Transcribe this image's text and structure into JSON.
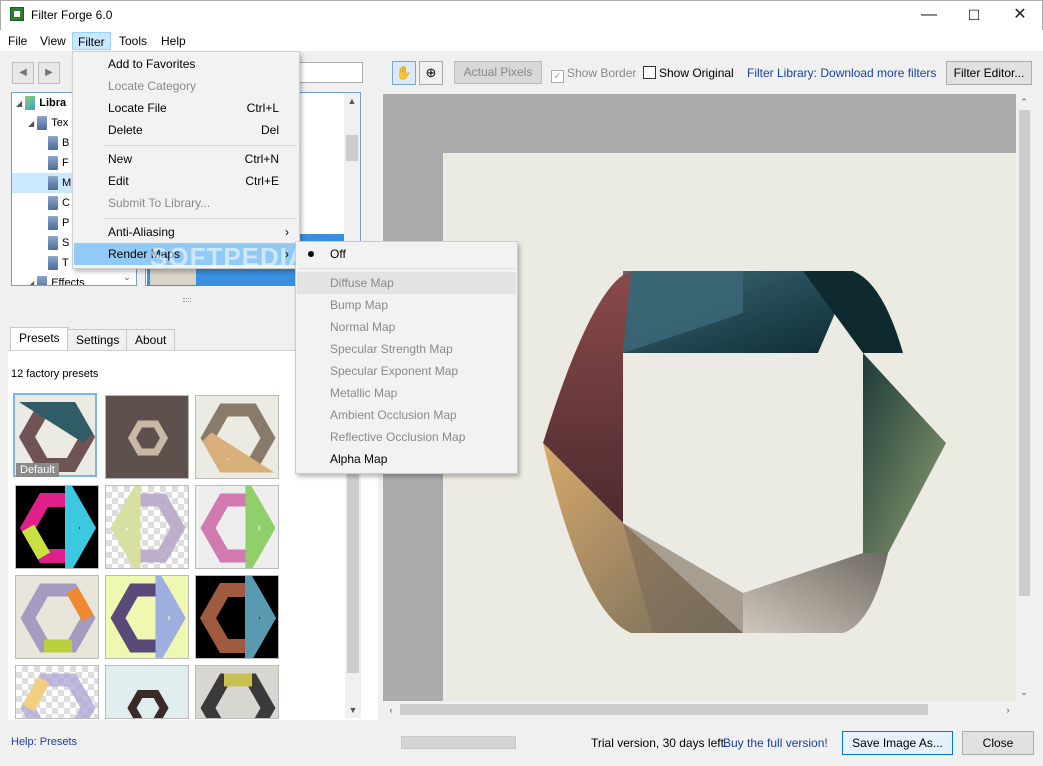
{
  "window": {
    "title": "Filter Forge 6.0",
    "minimize": "—",
    "maximize": "☐",
    "close": "✕"
  },
  "menubar": [
    "File",
    "View",
    "Filter",
    "Tools",
    "Help"
  ],
  "nav": {
    "back": "◀",
    "forward": "▶"
  },
  "tree": [
    {
      "label": "Libra",
      "expander": "◢",
      "indent": 0
    },
    {
      "label": "Tex",
      "expander": "◢",
      "indent": 1
    },
    {
      "label": "B",
      "indent": 2
    },
    {
      "label": "F",
      "indent": 2
    },
    {
      "label": "M",
      "indent": 2,
      "selected": true
    },
    {
      "label": "C",
      "indent": 2
    },
    {
      "label": "P",
      "indent": 2
    },
    {
      "label": "S",
      "indent": 2
    },
    {
      "label": "T",
      "indent": 2
    },
    {
      "label": "Effects",
      "expander": "◢",
      "indent": 1
    }
  ],
  "tabs": [
    "Presets",
    "Settings",
    "About"
  ],
  "presets": {
    "count_label": "12 factory presets",
    "default_label": "Default"
  },
  "help_link": "Help: Presets",
  "toolbar": {
    "hand_icon": "✋",
    "zoom_icon": "⊕",
    "actual_pixels": "Actual Pixels",
    "show_border": "Show Border",
    "show_border_checked": true,
    "show_original": "Show Original",
    "show_original_checked": false,
    "library_link": "Filter Library: Download more filters",
    "filter_editor": "Filter Editor..."
  },
  "status": {
    "trial": "Trial version, 30 days left.",
    "buy": "Buy the full version!",
    "save": "Save Image As...",
    "close": "Close"
  },
  "filter_menu": [
    {
      "label": "Add to Favorites",
      "shortcut": "",
      "disabled": false
    },
    {
      "label": "Locate Category",
      "shortcut": "",
      "disabled": true
    },
    {
      "label": "Locate File",
      "shortcut": "Ctrl+L",
      "disabled": false
    },
    {
      "label": "Delete",
      "shortcut": "Del",
      "disabled": false
    },
    {
      "label": "New",
      "shortcut": "Ctrl+N",
      "disabled": false
    },
    {
      "label": "Edit",
      "shortcut": "Ctrl+E",
      "disabled": false
    },
    {
      "label": "Submit To Library...",
      "shortcut": "",
      "disabled": true
    },
    {
      "label": "Anti-Aliasing",
      "shortcut": "",
      "disabled": false,
      "submenu": true
    },
    {
      "label": "Render Maps",
      "shortcut": "",
      "disabled": false,
      "submenu": true,
      "highlighted": true
    }
  ],
  "render_maps_menu": [
    {
      "label": "Off",
      "checked": true,
      "disabled": false
    },
    {
      "label": "Diffuse Map",
      "disabled": true,
      "hover": true
    },
    {
      "label": "Bump Map",
      "disabled": true
    },
    {
      "label": "Normal Map",
      "disabled": true
    },
    {
      "label": "Specular Strength Map",
      "disabled": true
    },
    {
      "label": "Specular Exponent Map",
      "disabled": true
    },
    {
      "label": "Metallic Map",
      "disabled": true
    },
    {
      "label": "Ambient Occlusion Map",
      "disabled": true
    },
    {
      "label": "Reflective Occlusion Map",
      "disabled": true
    },
    {
      "label": "Alpha Map",
      "disabled": false
    }
  ],
  "watermark": "SOFTPEDIA",
  "colors": {
    "accent": "#0078d7",
    "link": "#1a3fa8",
    "menu_highlight": "#91c9f7",
    "canvas_bg": "#ecebe3",
    "preview_bg": "#ababab"
  }
}
